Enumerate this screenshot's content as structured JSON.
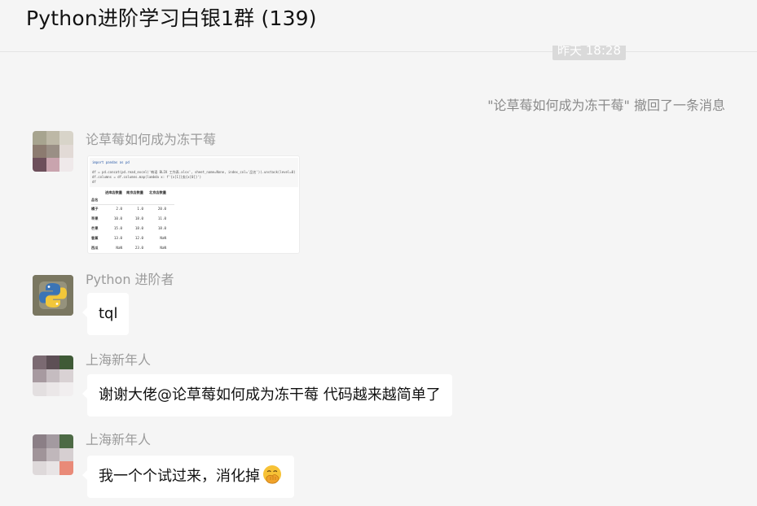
{
  "header": {
    "title": "Python进阶学习白银1群 (139)"
  },
  "timestamp": "昨天 18:28",
  "system_notice": "\"论草莓如何成为冻干莓\" 撤回了一条消息",
  "messages": [
    {
      "sender": "论草莓如何成为冻干莓",
      "type": "image",
      "image": {
        "code_lines": [
          "import pandas as pd",
          "df = pd.concat(pd.read_excel('韩语 BLIK 工作表.xlsx', sheet_name=None, index_col='品名')).unstack(level=0)",
          "df.columns = df.columns.map(lambda x: f'{x[1]}卖{x[0]}')",
          "df"
        ],
        "table": {
          "columns": [
            "进库店数量",
            "南京店数量",
            "北京店数量"
          ],
          "index_name": "品名",
          "rows": [
            {
              "name": "橘子",
              "values": [
                "2.0",
                "1.0",
                "20.0"
              ]
            },
            {
              "name": "苹果",
              "values": [
                "10.0",
                "18.0",
                "11.0"
              ]
            },
            {
              "name": "芒果",
              "values": [
                "15.0",
                "18.0",
                "18.0"
              ]
            },
            {
              "name": "香蕉",
              "values": [
                "13.0",
                "12.0",
                "NaN"
              ]
            },
            {
              "name": "西瓜",
              "values": [
                "NaN",
                "23.0",
                "NaN"
              ]
            }
          ]
        }
      }
    },
    {
      "sender": "Python 进阶者",
      "type": "text",
      "text": "tql"
    },
    {
      "sender": "上海新年人",
      "type": "text",
      "text": "谢谢大佬@论草莓如何成为冻干莓 代码越来越简单了"
    },
    {
      "sender": "上海新年人",
      "type": "text",
      "text": "我一个个试过来，消化掉",
      "emoji": "hand-over-mouth-face"
    }
  ],
  "colors": {
    "background": "#f5f5f5",
    "bubble": "#ffffff",
    "name_text": "#9b9b9b",
    "system_text": "#8a8a8a"
  }
}
